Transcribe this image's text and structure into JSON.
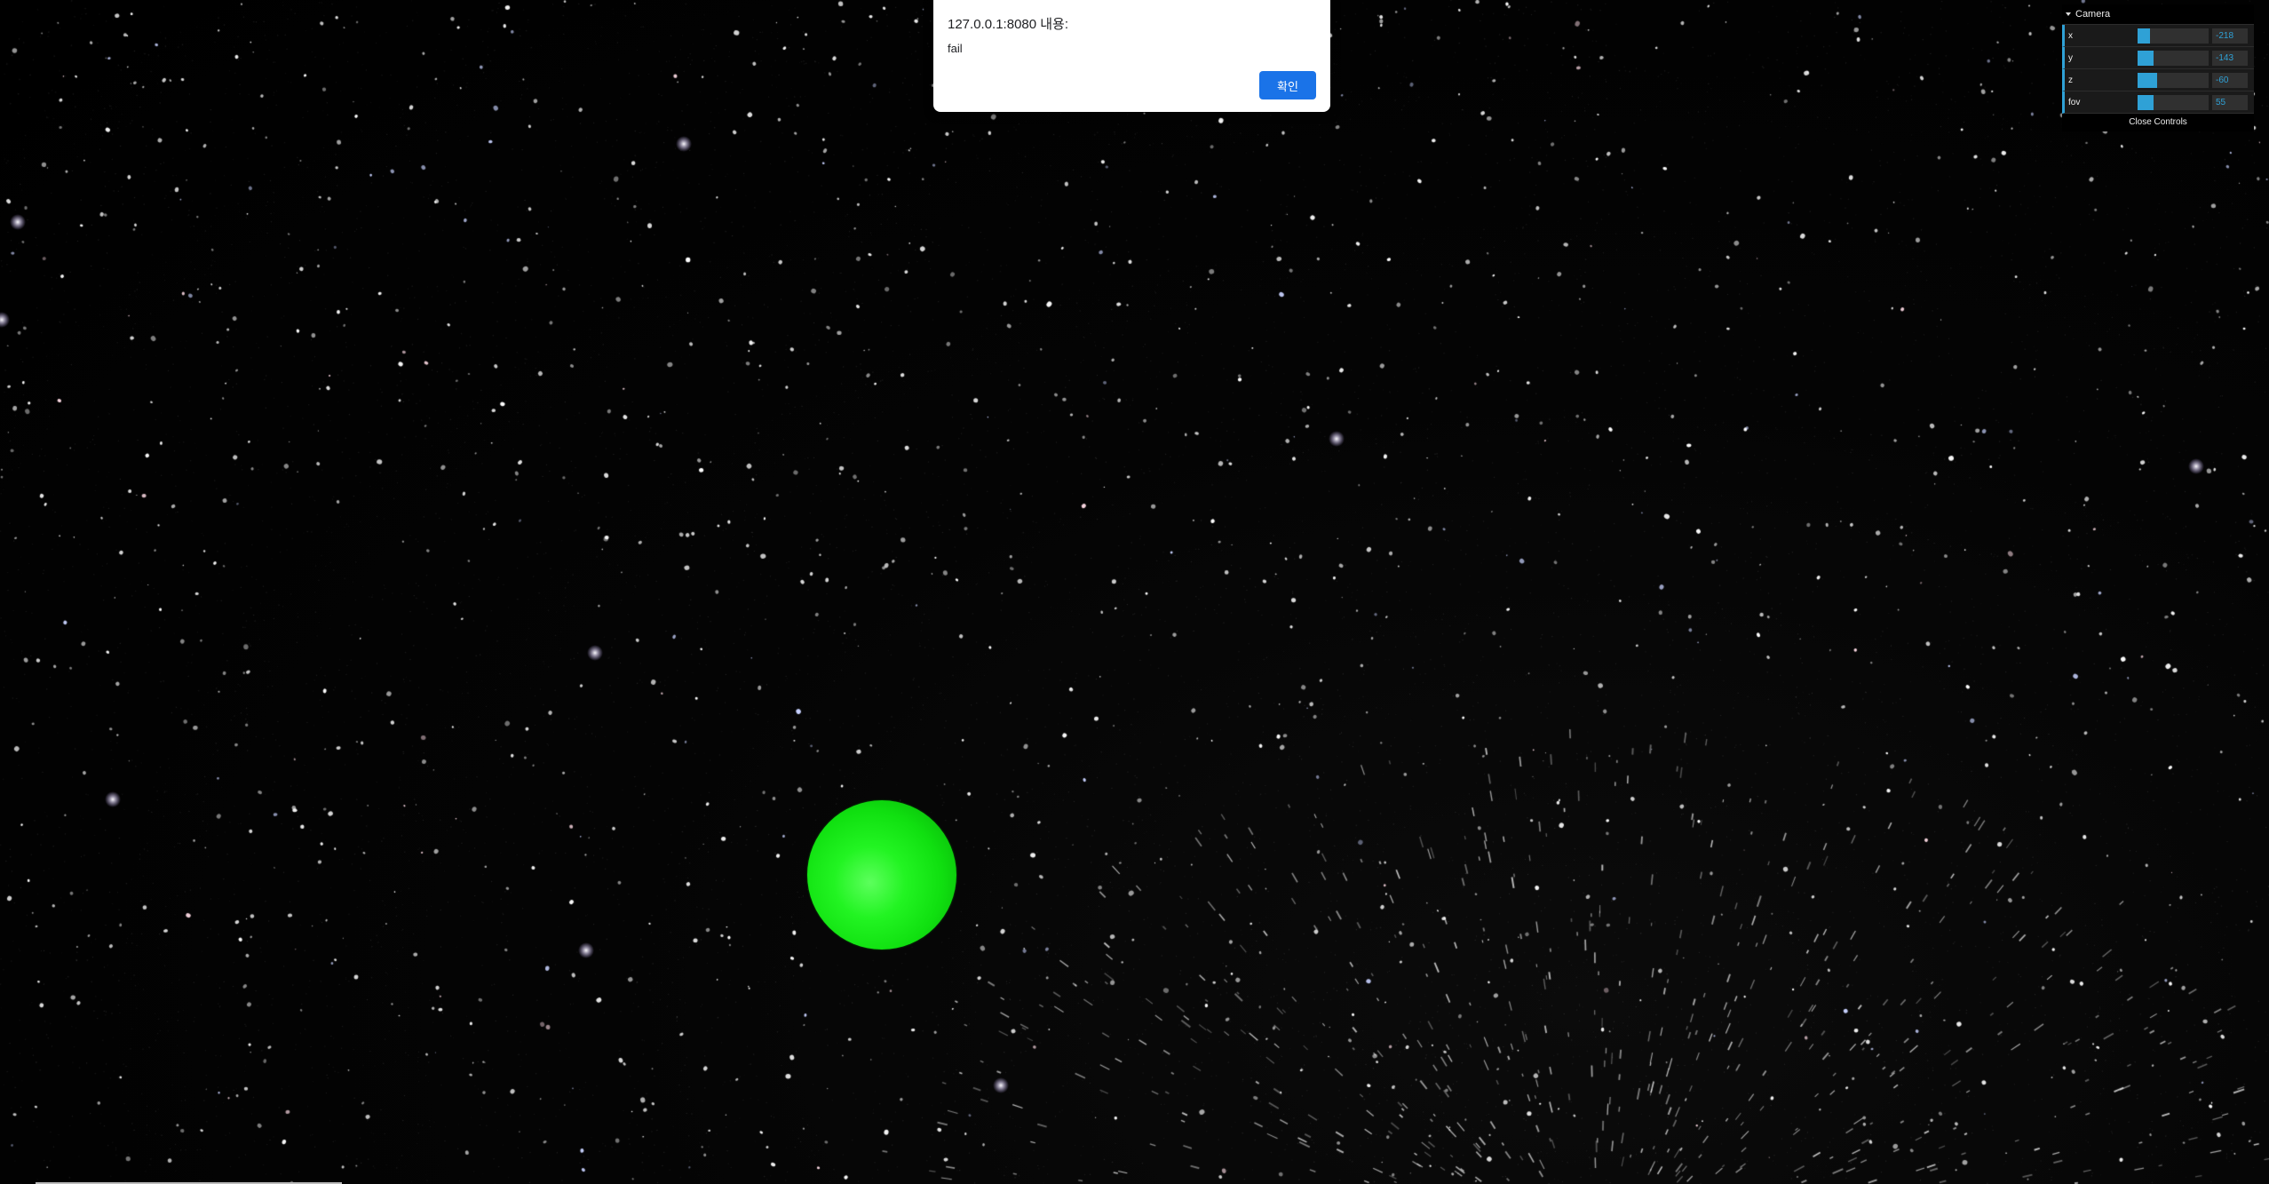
{
  "alert": {
    "title": "127.0.0.1:8080 내용:",
    "message": "fail",
    "ok_label": "확인"
  },
  "gui": {
    "folder_title": "Camera",
    "controls": [
      {
        "label": "x",
        "value": "-218",
        "fraction": 0.18
      },
      {
        "label": "y",
        "value": "-143",
        "fraction": 0.23
      },
      {
        "label": "z",
        "value": "-60",
        "fraction": 0.28
      },
      {
        "label": "fov",
        "value": "55",
        "fraction": 0.23
      }
    ],
    "close_label": "Close Controls"
  },
  "colors": {
    "background": "#000000",
    "sphere": "#11e011",
    "gui_accent": "#2fa1d6",
    "button": "#1a73e8"
  }
}
